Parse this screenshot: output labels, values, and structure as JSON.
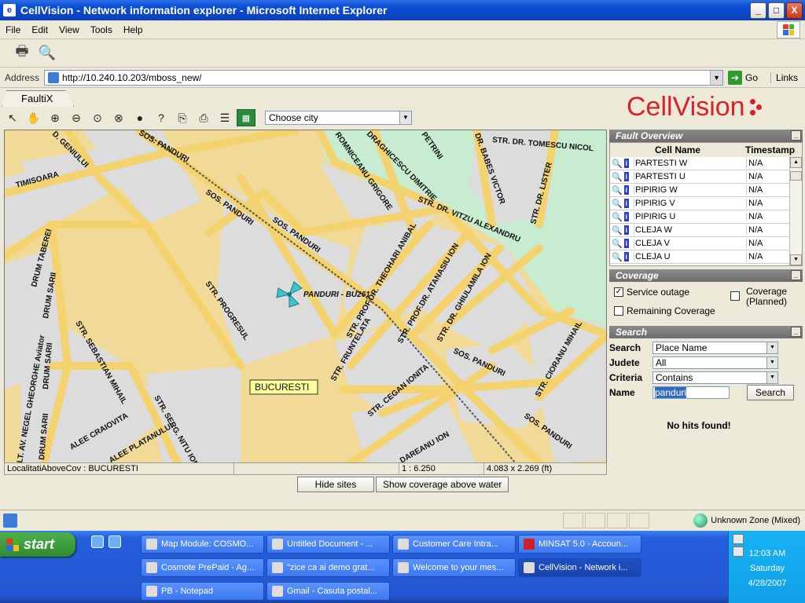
{
  "window": {
    "title": "CellVision - Network information explorer - Microsoft Internet Explorer",
    "buttons": {
      "minimize": "_",
      "maximize": "□",
      "close": "X"
    }
  },
  "menu": [
    "File",
    "Edit",
    "View",
    "Tools",
    "Help"
  ],
  "toolbar": {
    "icons": [
      "print-icon",
      "print-preview-icon"
    ]
  },
  "address": {
    "label": "Address",
    "url": "http://10.240.10.203/mboss_new/",
    "go": "Go",
    "links": "Links"
  },
  "app": {
    "tab": "FaultiX",
    "logo": "CellVision",
    "map_tools": [
      "pointer-icon",
      "pan-hand-icon",
      "zoom-in-icon",
      "zoom-out-icon",
      "zoom-extent-icon",
      "zoom-clear-icon",
      "circle-icon",
      "help-icon",
      "copy-icon",
      "print-icon",
      "legend-icon",
      "layers-icon"
    ],
    "city_select": "Choose city"
  },
  "map": {
    "streets": [
      "SOS. PANDURI",
      "SOS. PANDURI",
      "SOS. PANDURI",
      "SOS. PANDURI",
      "SOS. PANDURI",
      "STR. PROGRESUL",
      "STR. SEBASTIAN MIHAIL",
      "STR. SERG. NITU ION",
      "ALEE CRAIOVITA",
      "ALEE PLATANULUI",
      "DRUM TABEREI",
      "DRUM SARII",
      "DRUM SARII",
      "DRUM SARII",
      "TIMISOARA",
      "STR. FRUNTELATA",
      "STR. PROF.DR. THEOHARI ANIBAL",
      "STR. PROF.DR. ATANASIU ION",
      "STR. DR. GHIULAMILA ION",
      "STR. DR. VITZU ALEXANDRU",
      "STR. DR. LISTER",
      "STR. DR. TOMESCU NICOL",
      "ROMNICEANU GRIGORE",
      "DRAGHICESCU DIMITRIE",
      "PETRINI",
      "DR. BABES VICTOR",
      "STR. CEGAN IONITA",
      "STR. CIORANU MIHAIL",
      "D. GENIULUI",
      "DAREANU ION",
      "LT. AV. NEGEL GHEORGHE Aviator"
    ],
    "site_label": "PANDURI - BU261",
    "city_label": "BUCURESTI",
    "status": {
      "layer": "LocalitatiAboveCov : BUCURESTI",
      "scale": "1 : 6.250",
      "extent": "4.083 x 2.269 (ft)"
    }
  },
  "buttons": {
    "hide_sites": "Hide sites",
    "show_coverage": "Show coverage above water"
  },
  "fault_overview": {
    "title": "Fault Overview",
    "columns": [
      "Cell Name",
      "Timestamp"
    ],
    "rows": [
      {
        "name": "PARTESTI W",
        "ts": "N/A"
      },
      {
        "name": "PARTESTI U",
        "ts": "N/A"
      },
      {
        "name": "PIPIRIG W",
        "ts": "N/A"
      },
      {
        "name": "PIPIRIG V",
        "ts": "N/A"
      },
      {
        "name": "PIPIRIG U",
        "ts": "N/A"
      },
      {
        "name": "CLEJA W",
        "ts": "N/A"
      },
      {
        "name": "CLEJA V",
        "ts": "N/A"
      },
      {
        "name": "CLEJA U",
        "ts": "N/A"
      }
    ]
  },
  "coverage": {
    "title": "Coverage",
    "service_outage": "Service outage",
    "service_outage_checked": true,
    "remaining": "Remaining Coverage",
    "planned_1": "Coverage",
    "planned_2": "(Planned)"
  },
  "search": {
    "title": "Search",
    "search_label": "Search",
    "search_value": "Place Name",
    "judete_label": "Judete",
    "judete_value": "All",
    "criteria_label": "Criteria",
    "criteria_value": "Contains",
    "name_label": "Name",
    "name_value": "panduri",
    "button": "Search",
    "result": "No hits found!"
  },
  "ie_status": {
    "zone": "Unknown Zone (Mixed)"
  },
  "taskbar": {
    "start": "start",
    "tasks": [
      "Map Module: COSMO...",
      "Untitled Document - ...",
      "Customer Care Intra...",
      "MINSAT 5.0 - Accoun...",
      "Cosmote PrePaid - Ag...",
      "\"zice ca ai demo grat...",
      "Welcome to your mes...",
      "CellVision - Network i...",
      "PB - Notepad",
      "Gmail - Casuta postal..."
    ],
    "clock": {
      "time": "12:03 AM",
      "day": "Saturday",
      "date": "4/28/2007"
    }
  }
}
